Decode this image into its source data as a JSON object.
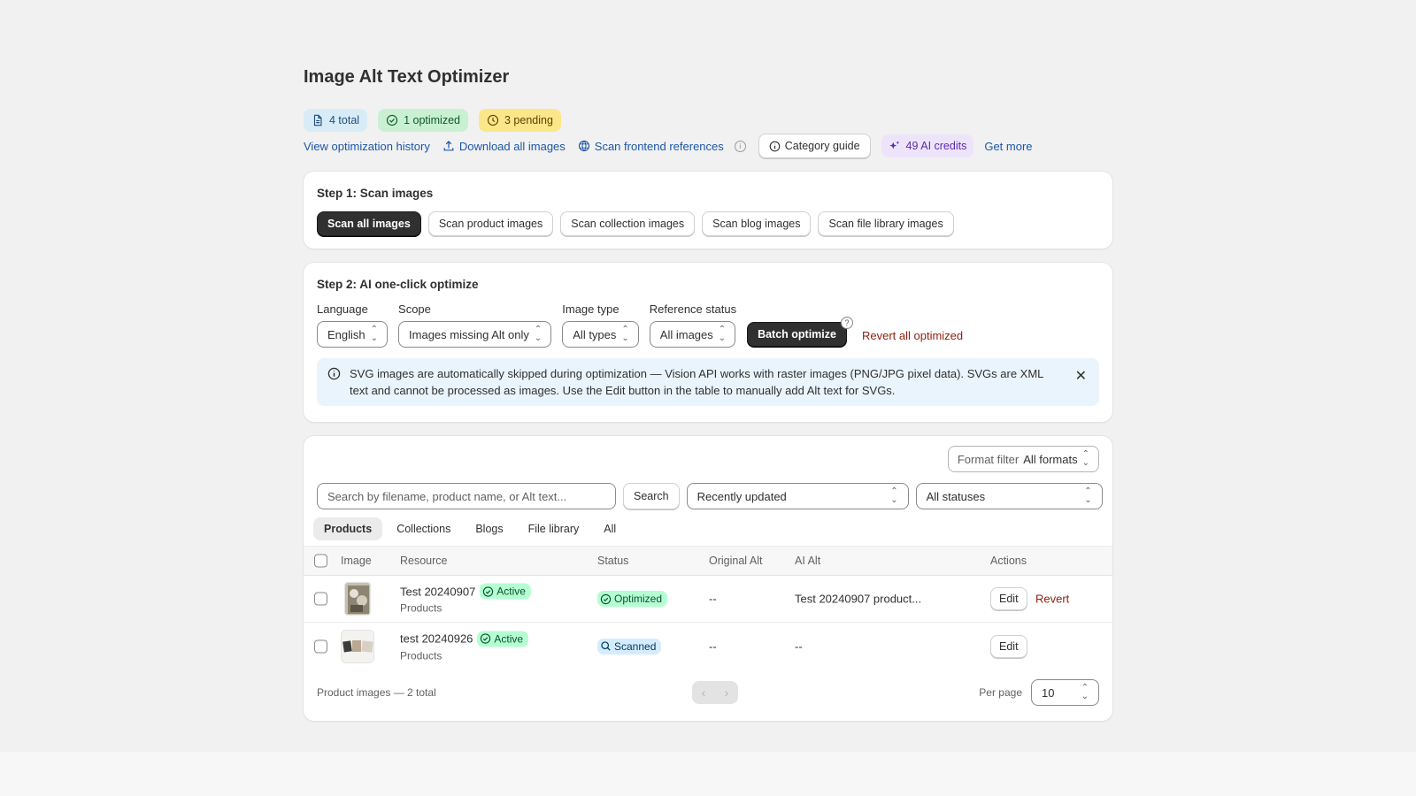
{
  "page": {
    "title": "Image Alt Text Optimizer"
  },
  "badges": {
    "total": "4 total",
    "optimized": "1 optimized",
    "pending": "3 pending"
  },
  "toolbar": {
    "history": "View optimization history",
    "download": "Download all images",
    "scan_frontend": "Scan frontend references",
    "category_guide": "Category guide",
    "credits": "49 AI credits",
    "get_more": "Get more"
  },
  "step1": {
    "title": "Step 1: Scan images",
    "buttons": [
      "Scan all images",
      "Scan product images",
      "Scan collection images",
      "Scan blog images",
      "Scan file library images"
    ]
  },
  "step2": {
    "title": "Step 2: AI one-click optimize",
    "language": {
      "label": "Language",
      "value": "English"
    },
    "scope": {
      "label": "Scope",
      "value": "Images missing Alt only"
    },
    "image_type": {
      "label": "Image type",
      "value": "All types"
    },
    "reference_status": {
      "label": "Reference status",
      "value": "All images"
    },
    "batch_optimize": "Batch optimize",
    "help": "?",
    "revert_all": "Revert all optimized",
    "banner": "SVG images are automatically skipped during optimization — Vision API works with raster images (PNG/JPG pixel data). SVGs are XML text and cannot be processed as images. Use the Edit button in the table to manually add Alt text for SVGs."
  },
  "table_card": {
    "format_filter": {
      "label": "Format filter",
      "value": "All formats"
    },
    "search": {
      "placeholder": "Search by filename, product name, or Alt text...",
      "button": "Search"
    },
    "sort": "Recently updated",
    "status_filter": "All statuses",
    "tabs": [
      "Products",
      "Collections",
      "Blogs",
      "File library",
      "All"
    ],
    "active_tab": "Products",
    "columns": [
      "Image",
      "Resource",
      "Status",
      "Original Alt",
      "AI Alt",
      "Actions"
    ],
    "rows": [
      {
        "name": "Test 20240907",
        "state": "Active",
        "type": "Products",
        "status": "Optimized",
        "original_alt": "--",
        "ai_alt": "Test 20240907 product...",
        "edit": "Edit",
        "revert": "Revert"
      },
      {
        "name": "test 20240926",
        "state": "Active",
        "type": "Products",
        "status": "Scanned",
        "original_alt": "--",
        "ai_alt": "--",
        "edit": "Edit",
        "revert": ""
      }
    ],
    "footer": "Product images — 2 total",
    "per_page_label": "Per page",
    "per_page": "10"
  },
  "colors": {
    "accent_dark": "#303030",
    "link": "#1d56a8",
    "critical": "#8e1f0b",
    "success_bg": "#b4fed2",
    "info_bg": "#d5ebff"
  }
}
